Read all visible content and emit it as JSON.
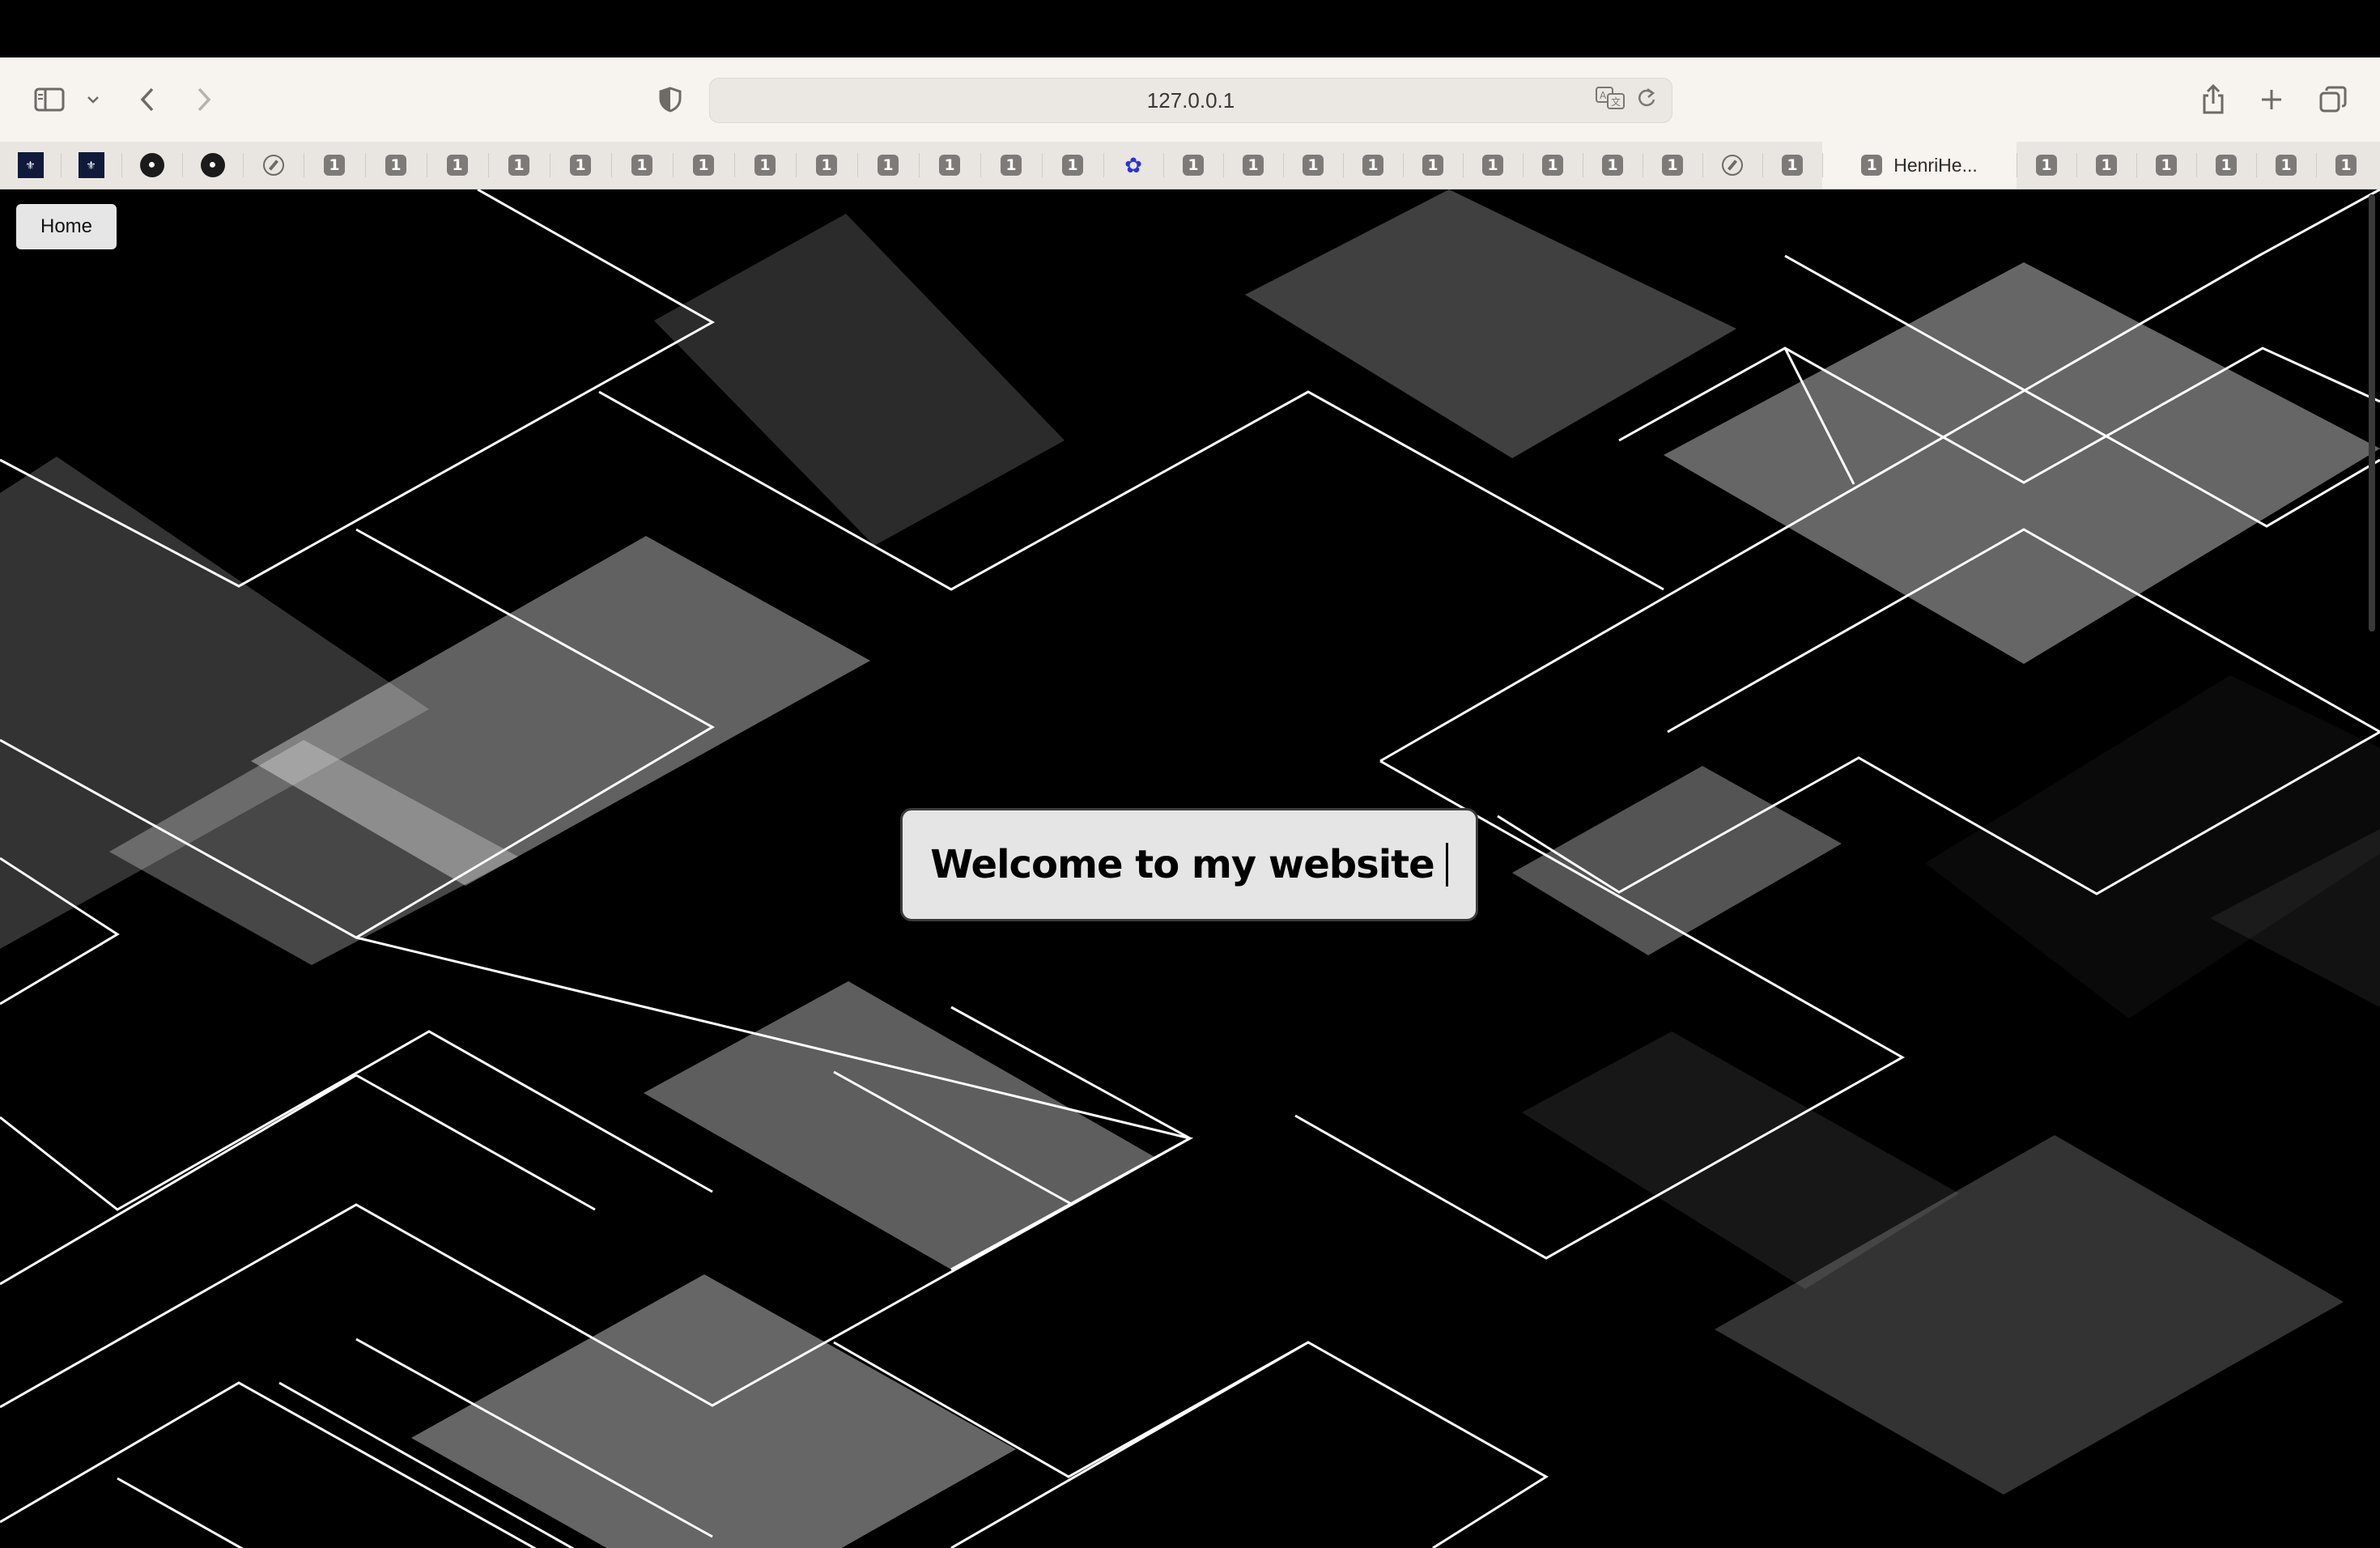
{
  "browser": {
    "url": "127.0.0.1",
    "tabs": [
      {
        "icon": "university-logo-icon"
      },
      {
        "icon": "university-logo-icon"
      },
      {
        "icon": "github-icon"
      },
      {
        "icon": "github-icon"
      },
      {
        "icon": "compass-icon"
      },
      {
        "icon": "number-badge-icon",
        "badge": "1"
      },
      {
        "icon": "number-badge-icon",
        "badge": "1"
      },
      {
        "icon": "number-badge-icon",
        "badge": "1"
      },
      {
        "icon": "number-badge-icon",
        "badge": "1"
      },
      {
        "icon": "number-badge-icon",
        "badge": "1"
      },
      {
        "icon": "number-badge-icon",
        "badge": "1"
      },
      {
        "icon": "number-badge-icon",
        "badge": "1"
      },
      {
        "icon": "number-badge-icon",
        "badge": "1"
      },
      {
        "icon": "number-badge-icon",
        "badge": "1"
      },
      {
        "icon": "number-badge-icon",
        "badge": "1"
      },
      {
        "icon": "number-badge-icon",
        "badge": "1"
      },
      {
        "icon": "number-badge-icon",
        "badge": "1"
      },
      {
        "icon": "number-badge-icon",
        "badge": "1"
      },
      {
        "icon": "paw-icon"
      },
      {
        "icon": "number-badge-icon",
        "badge": "1"
      },
      {
        "icon": "number-badge-icon",
        "badge": "1"
      },
      {
        "icon": "number-badge-icon",
        "badge": "1"
      },
      {
        "icon": "number-badge-icon",
        "badge": "1"
      },
      {
        "icon": "number-badge-icon",
        "badge": "1"
      },
      {
        "icon": "number-badge-icon",
        "badge": "1"
      },
      {
        "icon": "number-badge-icon",
        "badge": "1"
      },
      {
        "icon": "number-badge-icon",
        "badge": "1"
      },
      {
        "icon": "number-badge-icon",
        "badge": "1"
      },
      {
        "icon": "compass-icon"
      },
      {
        "icon": "number-badge-icon",
        "badge": "1"
      },
      {
        "icon": "number-badge-icon",
        "badge": "1",
        "title": "HenriHe...",
        "active": true
      },
      {
        "icon": "number-badge-icon",
        "badge": "1"
      },
      {
        "icon": "number-badge-icon",
        "badge": "1"
      },
      {
        "icon": "number-badge-icon",
        "badge": "1"
      },
      {
        "icon": "number-badge-icon",
        "badge": "1"
      },
      {
        "icon": "number-badge-icon",
        "badge": "1"
      },
      {
        "icon": "number-badge-icon",
        "badge": "1"
      }
    ]
  },
  "page": {
    "home_label": "Home",
    "welcome_text": "Welcome to my website"
  },
  "colors": {
    "background": "#000000",
    "toolbar": "#f7f3ef",
    "tabbar": "#e9e6e2",
    "welcome_box": "#e5e5e5"
  }
}
